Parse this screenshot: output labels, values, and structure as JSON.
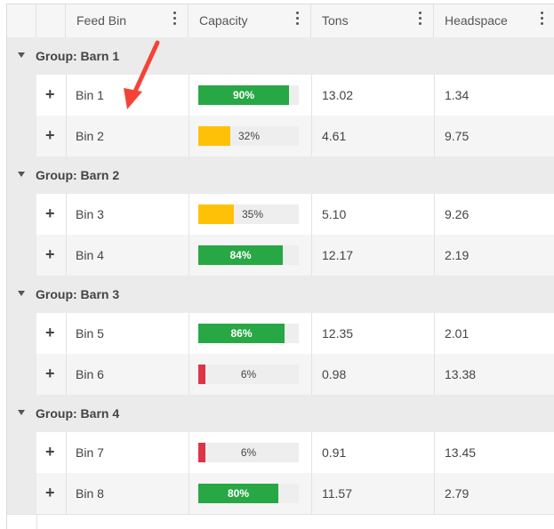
{
  "columns": [
    {
      "label": ""
    },
    {
      "label": ""
    },
    {
      "label": "Feed Bin"
    },
    {
      "label": "Capacity"
    },
    {
      "label": "Tons"
    },
    {
      "label": "Headspace"
    }
  ],
  "groups": [
    {
      "title": "Group: Barn 1",
      "rows": [
        {
          "bin": "Bin 1",
          "capacity": 90,
          "capacity_label": "90%",
          "bar_color": "#28a745",
          "tons": "13.02",
          "headspace": "1.34"
        },
        {
          "bin": "Bin 2",
          "capacity": 32,
          "capacity_label": "32%",
          "bar_color": "#ffc107",
          "tons": "4.61",
          "headspace": "9.75"
        }
      ]
    },
    {
      "title": "Group: Barn 2",
      "rows": [
        {
          "bin": "Bin 3",
          "capacity": 35,
          "capacity_label": "35%",
          "bar_color": "#ffc107",
          "tons": "5.10",
          "headspace": "9.26"
        },
        {
          "bin": "Bin 4",
          "capacity": 84,
          "capacity_label": "84%",
          "bar_color": "#28a745",
          "tons": "12.17",
          "headspace": "2.19"
        }
      ]
    },
    {
      "title": "Group: Barn 3",
      "rows": [
        {
          "bin": "Bin 5",
          "capacity": 86,
          "capacity_label": "86%",
          "bar_color": "#28a745",
          "tons": "12.35",
          "headspace": "2.01"
        },
        {
          "bin": "Bin 6",
          "capacity": 6,
          "capacity_label": "6%",
          "bar_color": "#dc3545",
          "tons": "0.98",
          "headspace": "13.38"
        }
      ]
    },
    {
      "title": "Group: Barn 4",
      "rows": [
        {
          "bin": "Bin 7",
          "capacity": 6,
          "capacity_label": "6%",
          "bar_color": "#dc3545",
          "tons": "0.91",
          "headspace": "13.45"
        },
        {
          "bin": "Bin 8",
          "capacity": 80,
          "capacity_label": "80%",
          "bar_color": "#28a745",
          "tons": "11.57",
          "headspace": "2.79"
        }
      ]
    }
  ],
  "icons": {
    "expand": "+",
    "collapse": "triangle-down",
    "column_menu": "kebab-vertical-icon"
  },
  "annotation": {
    "type": "red-arrow",
    "color": "#f44336"
  }
}
